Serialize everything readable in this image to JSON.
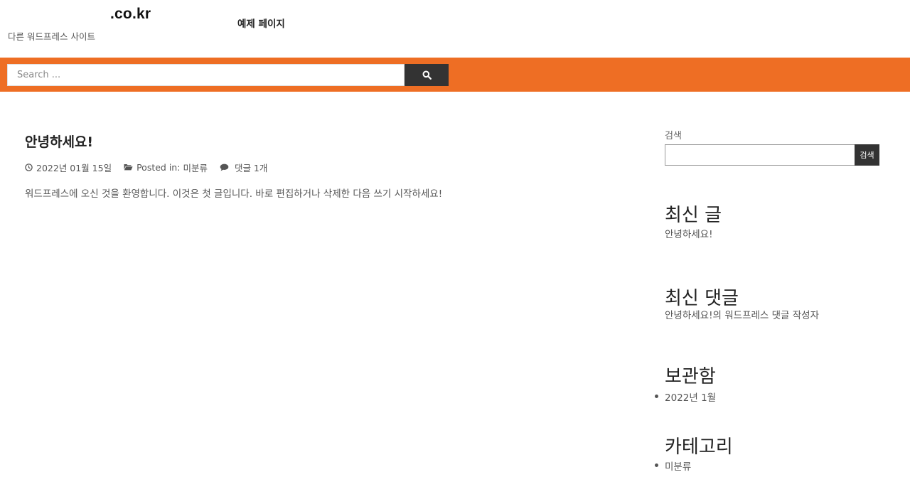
{
  "header": {
    "site_title": ".co.kr",
    "tagline": "다른 워드프레스 사이트",
    "nav": [
      {
        "label": "예제 페이지"
      }
    ]
  },
  "search_bar": {
    "placeholder": "Search ...",
    "button_icon": "search-icon"
  },
  "post": {
    "title": "안녕하세요!",
    "date": "2022년 01월 15일",
    "category_prefix": "Posted in:",
    "category": "미분류",
    "comments": "댓글 1개",
    "excerpt": "워드프레스에 오신 것을 환영합니다. 이것은 첫 글입니다. 바로 편집하거나 삭제한 다음 쓰기 시작하세요!"
  },
  "sidebar": {
    "search": {
      "label": "검색",
      "value": "",
      "button_label": "검색"
    },
    "recent_posts": {
      "title": "최신 글",
      "items": [
        "안녕하세요!"
      ]
    },
    "recent_comments": {
      "title": "최신 댓글",
      "post": "안녕하세요!",
      "connector": "의",
      "author": "워드프레스 댓글 작성자"
    },
    "archives": {
      "title": "보관함",
      "items": [
        "2022년 1월"
      ]
    },
    "categories": {
      "title": "카테고리",
      "items": [
        "미분류"
      ]
    }
  },
  "colors": {
    "accent": "#ee6e24",
    "dark": "#333333"
  }
}
